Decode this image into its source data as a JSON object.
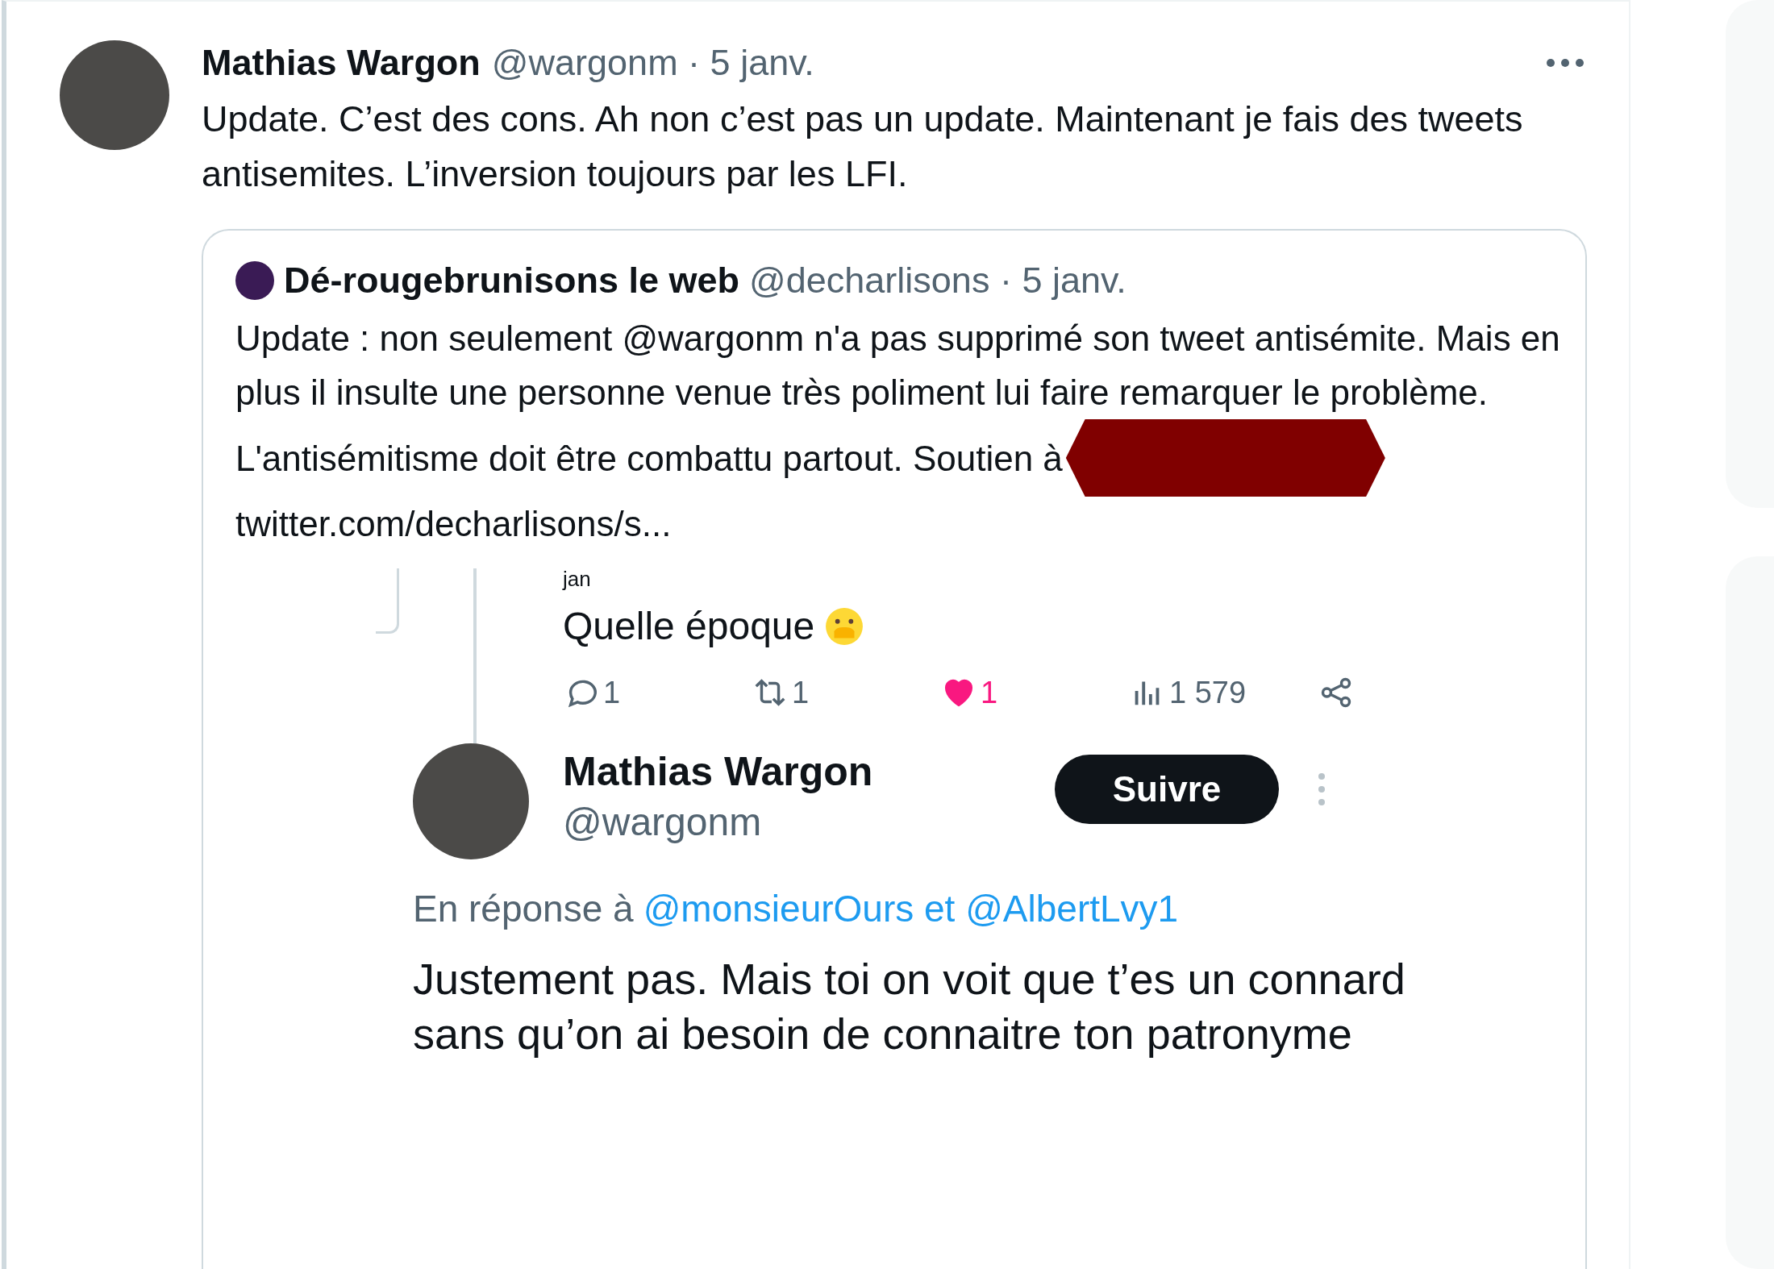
{
  "tweet": {
    "name": "Mathias Wargon",
    "meta": "@wargonm · 5 janv.",
    "text": "Update. C’est des cons. Ah non c’est pas un update. Maintenant je fais des tweets antisemites. L’inversion toujours par les LFI.",
    "quote": {
      "name": "Dé-rougebrunisons le web",
      "meta": "@decharlisons · 5 janv.",
      "paragraphs": [
        "Update : non seulement @wargonm n'a pas supprimé son tweet antisémite. Mais en plus il insulte une personne venue très poliment lui faire remarquer le problème.",
        "L'antisémitisme doit être combattu partout. Soutien à"
      ],
      "link": "twitter.com/decharlisons/s...",
      "image": {
        "partial_date": "jan",
        "text": "Quelle époque",
        "actions": [
          {
            "kind": "reply",
            "count": "1"
          },
          {
            "kind": "retweet",
            "count": "1"
          },
          {
            "kind": "like",
            "count": "1",
            "liked": true
          },
          {
            "kind": "views",
            "count": "1 579"
          },
          {
            "kind": "share"
          }
        ],
        "reply": {
          "name": "Mathias Wargon",
          "handle": "@wargonm",
          "follow": "Suivre",
          "reply_prefix": "En réponse à",
          "reply_to": "@monsieurOurs et @AlbertLvy1",
          "text": "Justement pas. Mais toi on voit que t’es un connard sans qu’on ai besoin de connaitre ton patronyme"
        }
      }
    }
  }
}
